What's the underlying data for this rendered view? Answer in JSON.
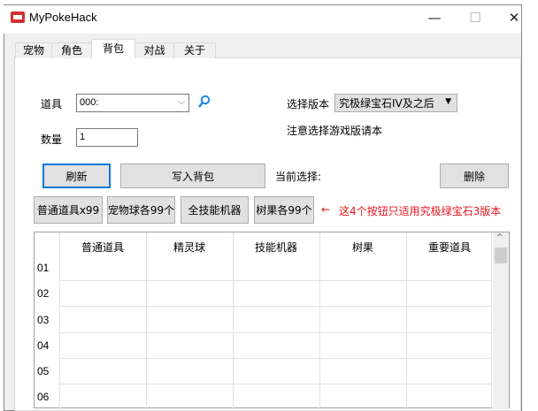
{
  "window": {
    "title": "MyPokeHack",
    "minimize": "—",
    "maximize": "☐",
    "close": "✕"
  },
  "tabs": [
    {
      "label": "宠物"
    },
    {
      "label": "角色"
    },
    {
      "label": "背包",
      "selected": true
    },
    {
      "label": "对战"
    },
    {
      "label": "关于"
    }
  ],
  "form": {
    "item_label": "道具",
    "item_value": "000:",
    "quantity_label": "数量",
    "quantity_value": "1",
    "version_label": "选择版本",
    "version_value": "究极绿宝石IV及之后",
    "version_note": "注意选择游戏版请本",
    "current_selection_label": "当前选择:"
  },
  "buttons": {
    "refresh": "刷新",
    "write_bag": "写入背包",
    "delete": "删除",
    "normal_items": "普通道具x99",
    "balls": "宠物球各99个",
    "all_tms": "全技能机器",
    "berries": "树果各99个"
  },
  "hint": {
    "arrow": "←",
    "text": "这4个按钮只适用究极绿宝石3版本"
  },
  "grid": {
    "columns": [
      "普通道具",
      "精灵球",
      "技能机器",
      "树果",
      "重要道具"
    ],
    "rows": [
      "01",
      "02",
      "03",
      "04",
      "05",
      "06"
    ]
  },
  "colors": {
    "accent": "#0078d7",
    "hint": "#e8131b"
  }
}
